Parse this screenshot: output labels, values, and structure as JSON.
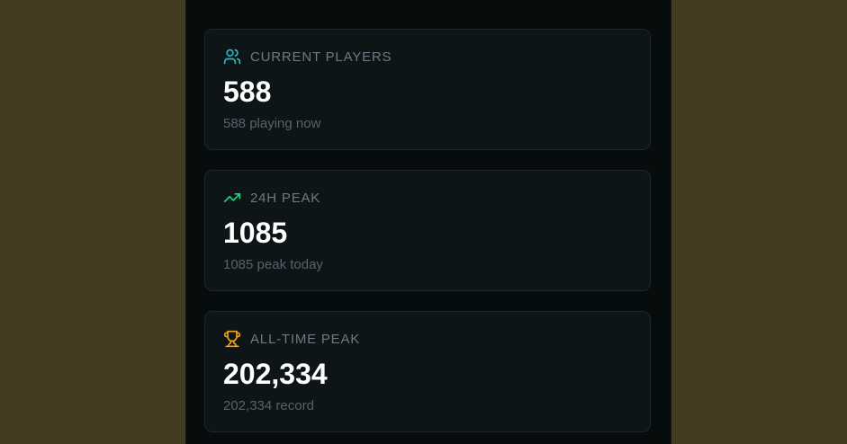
{
  "colors": {
    "page_bg": "#433b20",
    "panel_bg": "#070c0d",
    "card_bg": "#0e1516",
    "label": "#6c7a85",
    "sub": "#55636c",
    "users_icon": "#2bb8c6",
    "trend_icon": "#22d37c",
    "trophy_icon": "#f0a219"
  },
  "stats": [
    {
      "icon": "users-icon",
      "label": "CURRENT PLAYERS",
      "value": "588",
      "sub": "588 playing now"
    },
    {
      "icon": "trending-up-icon",
      "label": "24H PEAK",
      "value": "1085",
      "sub": "1085 peak today"
    },
    {
      "icon": "trophy-icon",
      "label": "ALL-TIME PEAK",
      "value": "202,334",
      "sub": "202,334 record"
    }
  ]
}
